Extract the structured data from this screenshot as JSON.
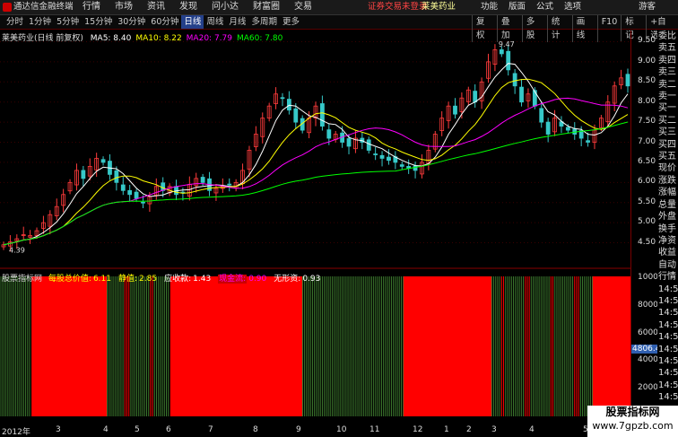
{
  "app": {
    "title": "通达信金融终端"
  },
  "menu": [
    {
      "label": "行情"
    },
    {
      "label": "市场"
    },
    {
      "label": "资讯"
    },
    {
      "label": "发现"
    },
    {
      "label": "问小达"
    },
    {
      "label": "财富圈"
    },
    {
      "label": "交易"
    }
  ],
  "notice": {
    "text": "证券交易未登录",
    "stock": "莱美药业"
  },
  "rightmenu": [
    {
      "label": "功能"
    },
    {
      "label": "版面"
    },
    {
      "label": "公式"
    },
    {
      "label": "选项"
    }
  ],
  "guest": {
    "label": "游客"
  },
  "periods": [
    {
      "label": "分时"
    },
    {
      "label": "1分钟"
    },
    {
      "label": "5分钟"
    },
    {
      "label": "15分钟"
    },
    {
      "label": "30分钟"
    },
    {
      "label": "60分钟"
    },
    {
      "label": "日线",
      "active": true
    },
    {
      "label": "周线"
    },
    {
      "label": "月线"
    },
    {
      "label": "多周期"
    },
    {
      "label": "更多"
    }
  ],
  "tools": [
    {
      "label": "复权"
    },
    {
      "label": "叠加"
    },
    {
      "label": "多股"
    },
    {
      "label": "统计"
    },
    {
      "label": "画线"
    },
    {
      "label": "F10"
    },
    {
      "label": "标记"
    },
    {
      "label": "+自选"
    }
  ],
  "main": {
    "stock": "莱美药业(日线 前复权)",
    "ma": [
      {
        "label": "MA5: 8.40",
        "color": "#ffffff"
      },
      {
        "label": "MA10: 8.22",
        "color": "#ffff00"
      },
      {
        "label": "MA20: 7.79",
        "color": "#ff00ff"
      },
      {
        "label": "MA60: 7.80",
        "color": "#00ff00"
      }
    ],
    "high_label": "9.47",
    "low_label": "4.39"
  },
  "sub": {
    "name": "股票指标网",
    "items": [
      {
        "label": "每股总价值:",
        "value": "6.11",
        "color": "#ffff00"
      },
      {
        "label": "静值:",
        "value": "2.85",
        "color": "#ffff00"
      },
      {
        "label": "应收款:",
        "value": "1.43",
        "color": "#ffffff"
      },
      {
        "label": "现金流:",
        "value": "0.90",
        "color": "#ff00ff",
        "tag": true
      },
      {
        "label": "无形资:",
        "value": "0.93",
        "color": "#ffffff"
      }
    ]
  },
  "yaxis_main": [
    "9.50",
    "9.00",
    "8.50",
    "8.00",
    "7.50",
    "7.00",
    "6.50",
    "6.00",
    "5.50",
    "5.00",
    "4.50"
  ],
  "yaxis_sub": [
    "10000",
    "8000",
    "6000",
    "4000",
    "2000"
  ],
  "yaxis_highlight": "4806.42",
  "rightpanel": [
    "委比",
    "卖五",
    "卖四",
    "卖三",
    "卖二",
    "卖一",
    "买一",
    "买二",
    "买三",
    "买四",
    "买五",
    "现价",
    "涨跌",
    "涨幅",
    "总量",
    "外盘",
    "换手",
    "净资",
    "收益",
    "自动",
    "行情",
    "14:50",
    "14:50",
    "14:50",
    "14:50",
    "14:50",
    "14:50",
    "14:50",
    "14:50",
    "14:50",
    "14:50",
    "14:50"
  ],
  "xaxis": [
    "2012年",
    "3",
    "4",
    "5",
    "6",
    "7",
    "8",
    "9",
    "10",
    "11",
    "12",
    "1",
    "2",
    "3",
    "4",
    "5"
  ],
  "watermark": {
    "line1": "股票指标网",
    "line2": "www.7gpzb.com"
  },
  "chart_data": {
    "type": "candlestick",
    "title": "莱美药业(日线 前复权)",
    "ylim": [
      4.2,
      9.6
    ],
    "closes": [
      4.45,
      4.52,
      4.6,
      4.7,
      4.68,
      4.8,
      5.0,
      5.2,
      5.4,
      5.7,
      6.0,
      6.3,
      6.1,
      6.4,
      6.6,
      6.5,
      6.2,
      6.0,
      5.8,
      5.7,
      5.6,
      5.5,
      5.65,
      5.9,
      5.8,
      5.9,
      5.7,
      5.75,
      5.95,
      6.1,
      6.0,
      5.8,
      5.85,
      5.9,
      5.95,
      6.0,
      6.3,
      6.8,
      7.2,
      7.6,
      7.9,
      8.2,
      8.1,
      7.8,
      7.5,
      7.3,
      7.6,
      7.9,
      7.4,
      7.1,
      7.2,
      7.0,
      6.9,
      7.1,
      7.0,
      6.8,
      6.7,
      6.6,
      6.55,
      6.5,
      6.4,
      6.35,
      6.3,
      6.5,
      6.8,
      7.2,
      7.6,
      7.9,
      7.7,
      8.1,
      8.3,
      8.0,
      8.5,
      9.0,
      9.3,
      9.2,
      8.8,
      8.4,
      8.0,
      8.2,
      7.9,
      7.5,
      7.2,
      7.6,
      7.4,
      7.3,
      7.2,
      7.1,
      7.0,
      7.3,
      7.6,
      8.0,
      8.4,
      8.6,
      8.4
    ],
    "ma5_last": 8.4,
    "ma10_last": 8.22,
    "ma20_last": 7.79,
    "ma60_last": 7.8,
    "sub_series": {
      "name": "股票指标网",
      "ylim": [
        0,
        10000
      ],
      "regions": [
        [
          0,
          0.05,
          "green"
        ],
        [
          0.05,
          0.17,
          "red"
        ],
        [
          0.17,
          0.27,
          "mixed"
        ],
        [
          0.27,
          0.48,
          "red"
        ],
        [
          0.48,
          0.64,
          "green"
        ],
        [
          0.64,
          0.78,
          "red"
        ],
        [
          0.78,
          0.94,
          "mixed"
        ],
        [
          0.94,
          1.0,
          "red"
        ]
      ]
    }
  }
}
